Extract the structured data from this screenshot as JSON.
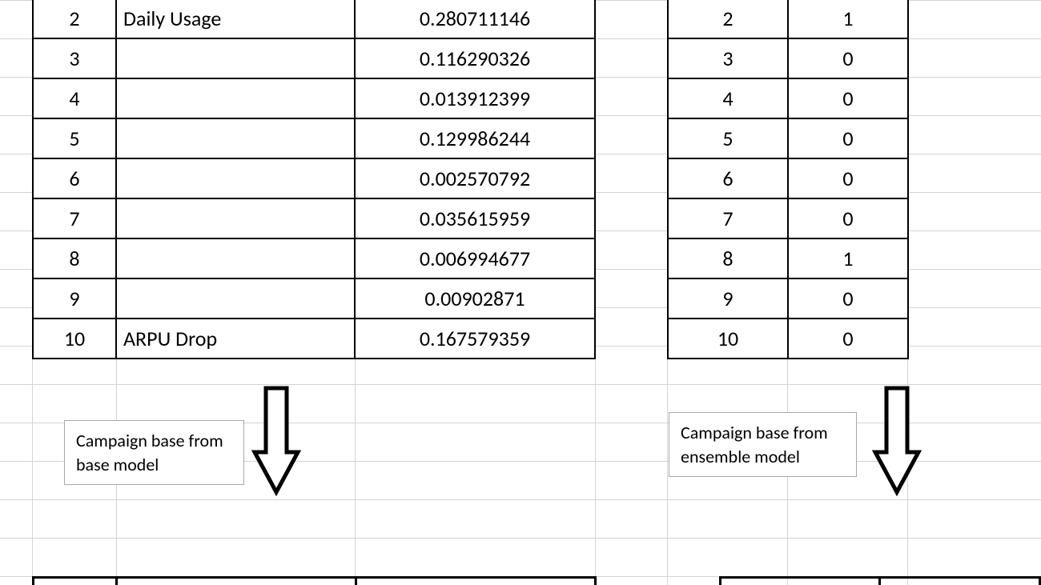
{
  "left_table": {
    "rows": [
      {
        "idx": "2",
        "label": "Daily Usage",
        "value": "0.280711146"
      },
      {
        "idx": "3",
        "label": "",
        "value": "0.116290326"
      },
      {
        "idx": "4",
        "label": "",
        "value": "0.013912399"
      },
      {
        "idx": "5",
        "label": "",
        "value": "0.129986244"
      },
      {
        "idx": "6",
        "label": "",
        "value": "0.002570792"
      },
      {
        "idx": "7",
        "label": "",
        "value": "0.035615959"
      },
      {
        "idx": "8",
        "label": "",
        "value": "0.006994677"
      },
      {
        "idx": "9",
        "label": "",
        "value": "0.00902871"
      },
      {
        "idx": "10",
        "label": "ARPU Drop",
        "value": "0.167579359"
      }
    ]
  },
  "right_table": {
    "rows": [
      {
        "idx": "2",
        "flag": "1"
      },
      {
        "idx": "3",
        "flag": "0"
      },
      {
        "idx": "4",
        "flag": "0"
      },
      {
        "idx": "5",
        "flag": "0"
      },
      {
        "idx": "6",
        "flag": "0"
      },
      {
        "idx": "7",
        "flag": "0"
      },
      {
        "idx": "8",
        "flag": "1"
      },
      {
        "idx": "9",
        "flag": "0"
      },
      {
        "idx": "10",
        "flag": "0"
      }
    ]
  },
  "notes": {
    "left": "Campaign base from base model",
    "right": "Campaign base from ensemble model"
  }
}
